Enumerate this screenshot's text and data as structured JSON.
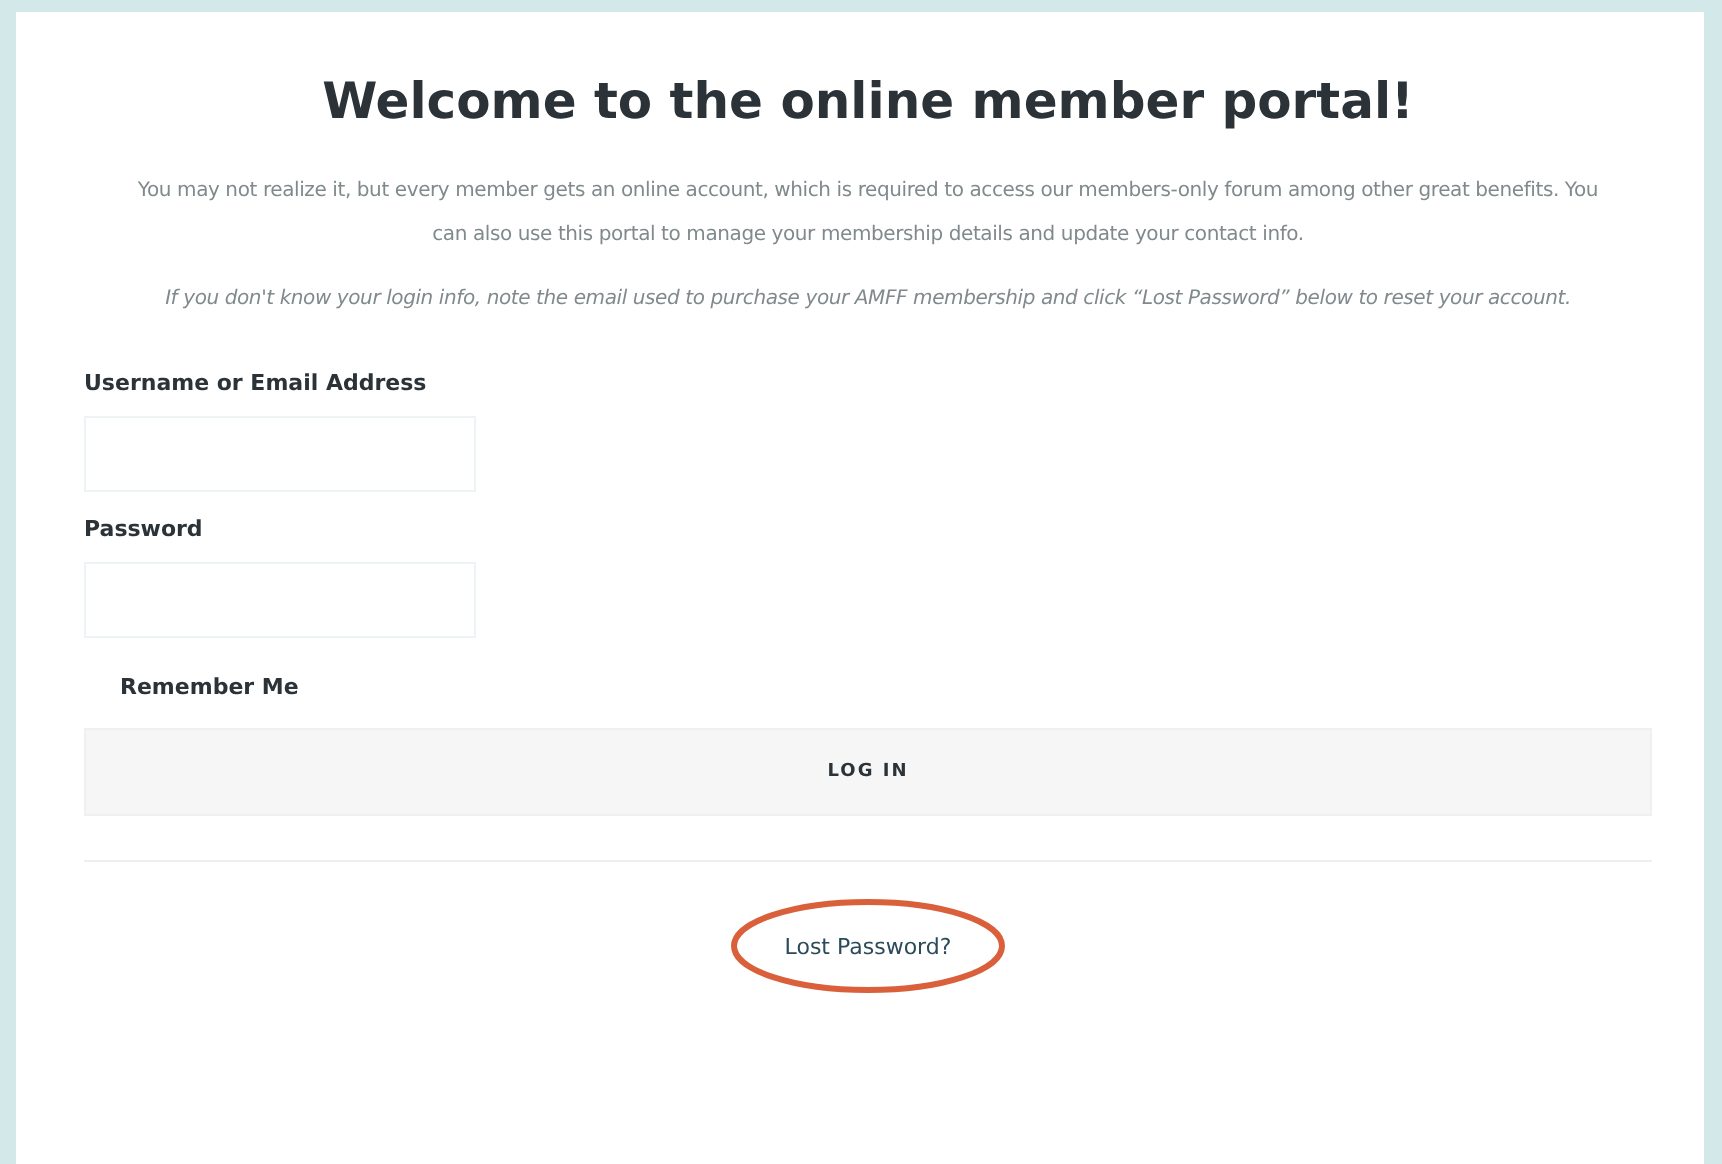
{
  "title": "Welcome to the online member portal!",
  "intro": "You may not realize it, but every member gets an online account, which is required to access our members-only forum among other great benefits. You can also use this portal to manage your membership details and update your contact info.",
  "note": "If you don't know your login info, note the email used to purchase your AMFF membership and click “Lost Password” below to reset your account.",
  "fields": [
    {
      "label": "Username or Email Address"
    },
    {
      "label": "Password"
    }
  ],
  "remember": {
    "label": "Remember Me"
  },
  "login_button": "LOG IN",
  "lost_password": {
    "label": "Lost Password?",
    "highlighted": true
  }
}
